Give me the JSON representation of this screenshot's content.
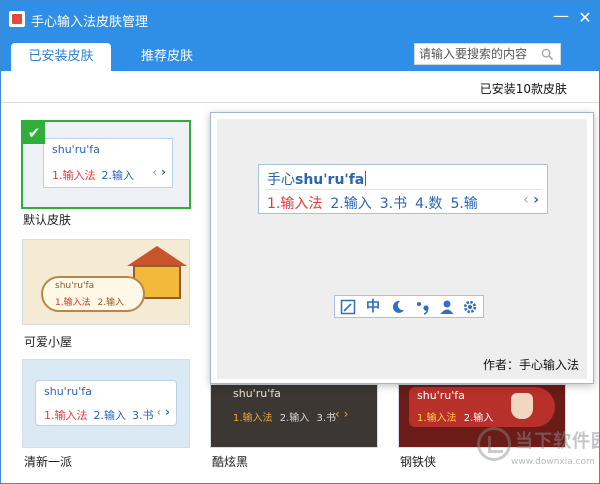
{
  "window": {
    "title": "手心输入法皮肤管理",
    "minimize_icon": "minimize-icon",
    "close_icon": "close-icon"
  },
  "tabs": [
    {
      "label": "已安装皮肤",
      "active": true
    },
    {
      "label": "推荐皮肤",
      "active": false
    }
  ],
  "search": {
    "placeholder": "请输入要搜索的内容",
    "value": ""
  },
  "summary": {
    "installed_text": "已安装10款皮肤"
  },
  "skins": [
    {
      "name": "默认皮肤",
      "selected": true,
      "pinyin": "shu'ru'fa",
      "candidates": [
        "1.输入法",
        "2.输入"
      ]
    },
    {
      "name": "可爱小屋",
      "selected": false,
      "pinyin": "shu'ru'fa",
      "candidates": [
        "1.输入法",
        "2.输入"
      ]
    },
    {
      "name": "清新一派",
      "selected": false,
      "pinyin": "shu'ru'fa",
      "candidates": [
        "1.输入法",
        "2.输入",
        "3.书"
      ]
    },
    {
      "name": "酷炫黑",
      "selected": false,
      "pinyin": "shu'ru'fa",
      "candidates": [
        "1.输入法",
        "2.输入",
        "3.书"
      ]
    },
    {
      "name": "钢铁侠",
      "selected": false,
      "pinyin": "shu'ru'fa",
      "candidates": [
        "1.输入法",
        "2.输入"
      ]
    }
  ],
  "preview": {
    "pinyin_prefix": "手心",
    "pinyin_typed": "shu'ru'fa",
    "candidates": [
      "1.输入法",
      "2.输入",
      "3.书",
      "4.数",
      "5.输"
    ],
    "status_bar": {
      "chinese_mode": "中",
      "icons": [
        "skin-icon",
        "moon-icon",
        "punctuation-icon",
        "user-icon",
        "gear-icon"
      ]
    },
    "author": "作者：手心输入法"
  },
  "colors": {
    "titlebar": "#2f8fe6",
    "selected_border": "#2fae3c",
    "candidate_first": "#e03a3a",
    "candidate_other": "#2a65b2"
  },
  "watermark": {
    "name": "当下软件园",
    "url": "www.downxia.com"
  }
}
